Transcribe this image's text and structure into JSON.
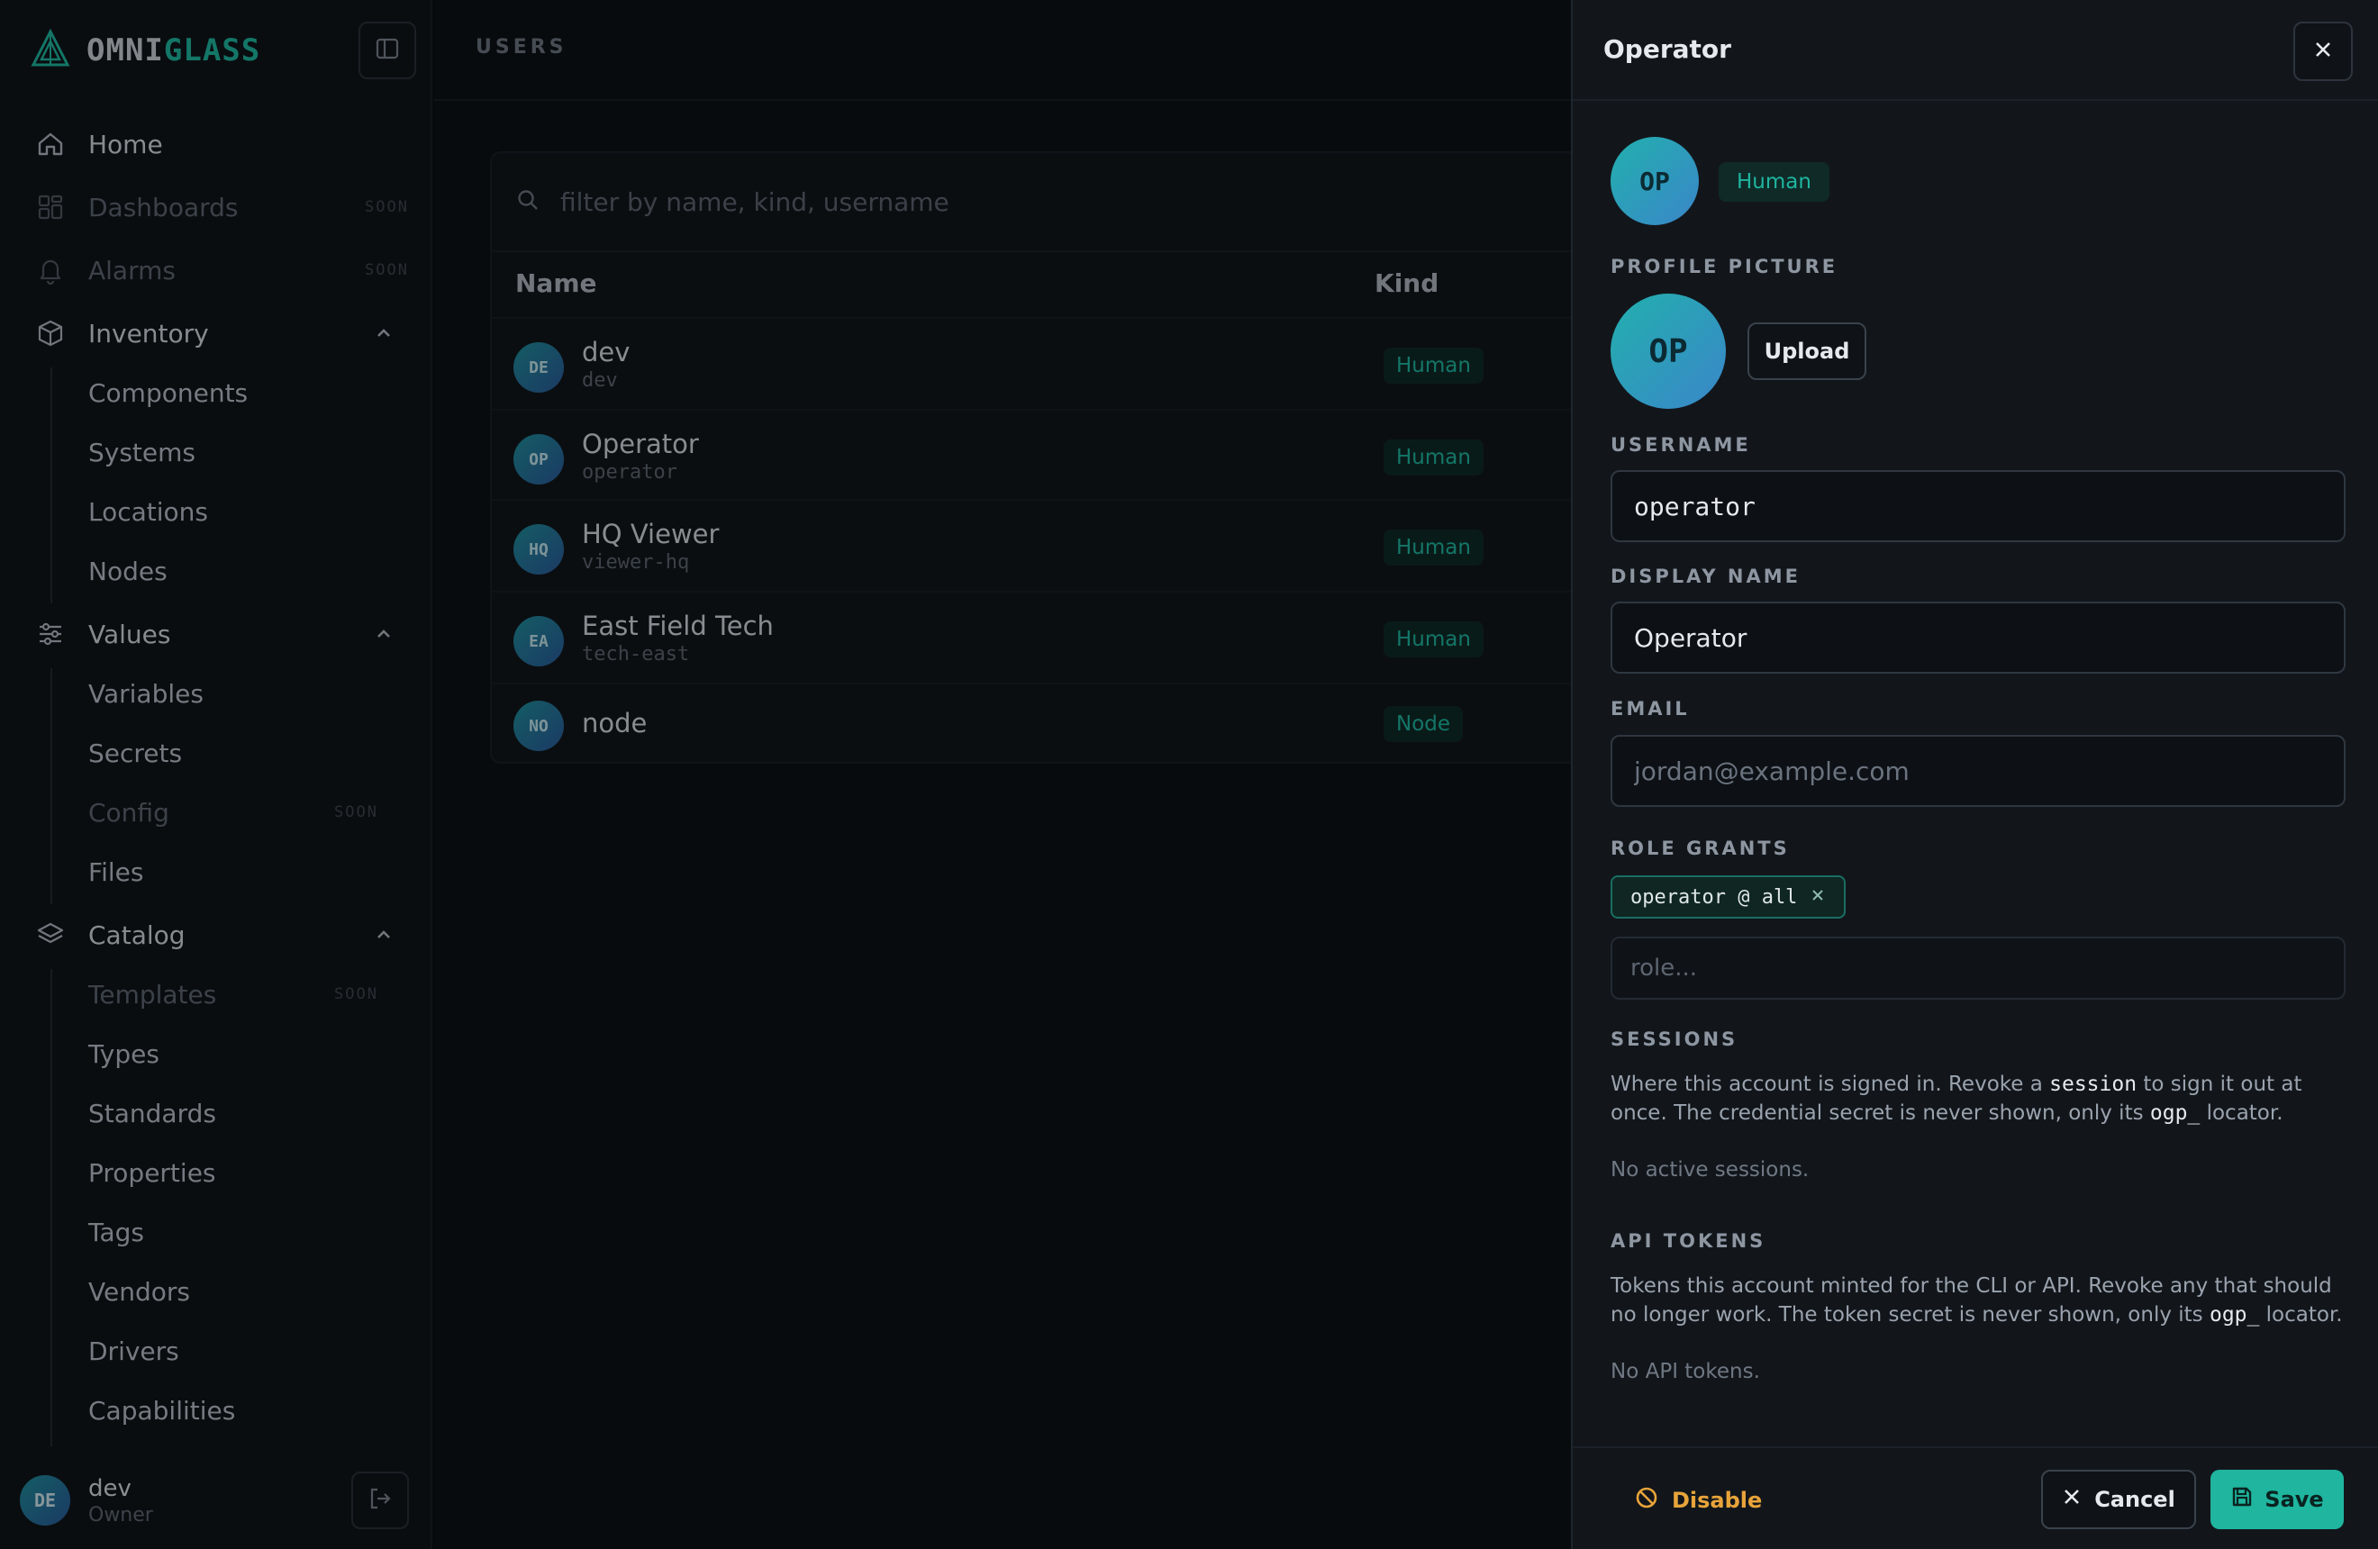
{
  "brand": {
    "part1": "OMNI",
    "part2": "GLASS"
  },
  "sidebar": {
    "nav": [
      {
        "label": "Home"
      },
      {
        "label": "Dashboards",
        "badge": "SOON"
      },
      {
        "label": "Alarms",
        "badge": "SOON"
      },
      {
        "label": "Inventory"
      },
      {
        "label": "Values"
      },
      {
        "label": "Catalog"
      }
    ],
    "inventory_items": [
      "Components",
      "Systems",
      "Locations",
      "Nodes"
    ],
    "values_items": [
      "Variables",
      "Secrets",
      "Config",
      "Files"
    ],
    "values_badge": "SOON",
    "catalog_items": [
      "Templates",
      "Types",
      "Standards",
      "Properties",
      "Tags",
      "Vendors",
      "Drivers",
      "Capabilities"
    ],
    "catalog_badge": "SOON",
    "user": {
      "initials": "DE",
      "name": "dev",
      "role": "Owner"
    }
  },
  "main": {
    "title": "USERS",
    "search_placeholder": "filter by name, kind, username",
    "columns": {
      "name": "Name",
      "kind": "Kind"
    },
    "rows": [
      {
        "initials": "DE",
        "name": "dev",
        "username": "dev",
        "kind": "Human"
      },
      {
        "initials": "OP",
        "name": "Operator",
        "username": "operator",
        "kind": "Human"
      },
      {
        "initials": "HQ",
        "name": "HQ Viewer",
        "username": "viewer-hq",
        "kind": "Human"
      },
      {
        "initials": "EA",
        "name": "East Field Tech",
        "username": "tech-east",
        "kind": "Human"
      },
      {
        "initials": "NO",
        "name": "node",
        "username": "",
        "kind": "Node"
      }
    ]
  },
  "drawer": {
    "title": "Operator",
    "initials": "OP",
    "kind_badge": "Human",
    "profile_picture_label": "PROFILE PICTURE",
    "upload_label": "Upload",
    "username_label": "USERNAME",
    "username_value": "operator",
    "display_name_label": "DISPLAY NAME",
    "display_name_value": "Operator",
    "email_label": "EMAIL",
    "email_placeholder": "jordan@example.com",
    "role_grants_label": "ROLE GRANTS",
    "role_chip": "operator @ all",
    "role_placeholder": "role...",
    "sessions_label": "SESSIONS",
    "sessions_text_1": "Where this account is signed in. Revoke a ",
    "sessions_code_1": "session",
    "sessions_text_2": " to sign it out at once. The credential secret is never shown, only its ",
    "sessions_code_2": "ogp_",
    "sessions_text_3": " locator.",
    "sessions_empty": "No active sessions.",
    "tokens_label": "API TOKENS",
    "tokens_text_1": "Tokens this account minted for the CLI or API. Revoke any that should no longer work. The token secret is never shown, only its ",
    "tokens_code": "ogp_",
    "tokens_text_2": " locator.",
    "tokens_empty": "No API tokens.",
    "disable_label": "Disable",
    "cancel_label": "Cancel",
    "save_label": "Save"
  },
  "colors": {
    "accent": "#1fb59f",
    "warning": "#e8a43a",
    "background": "#0b0f14"
  }
}
